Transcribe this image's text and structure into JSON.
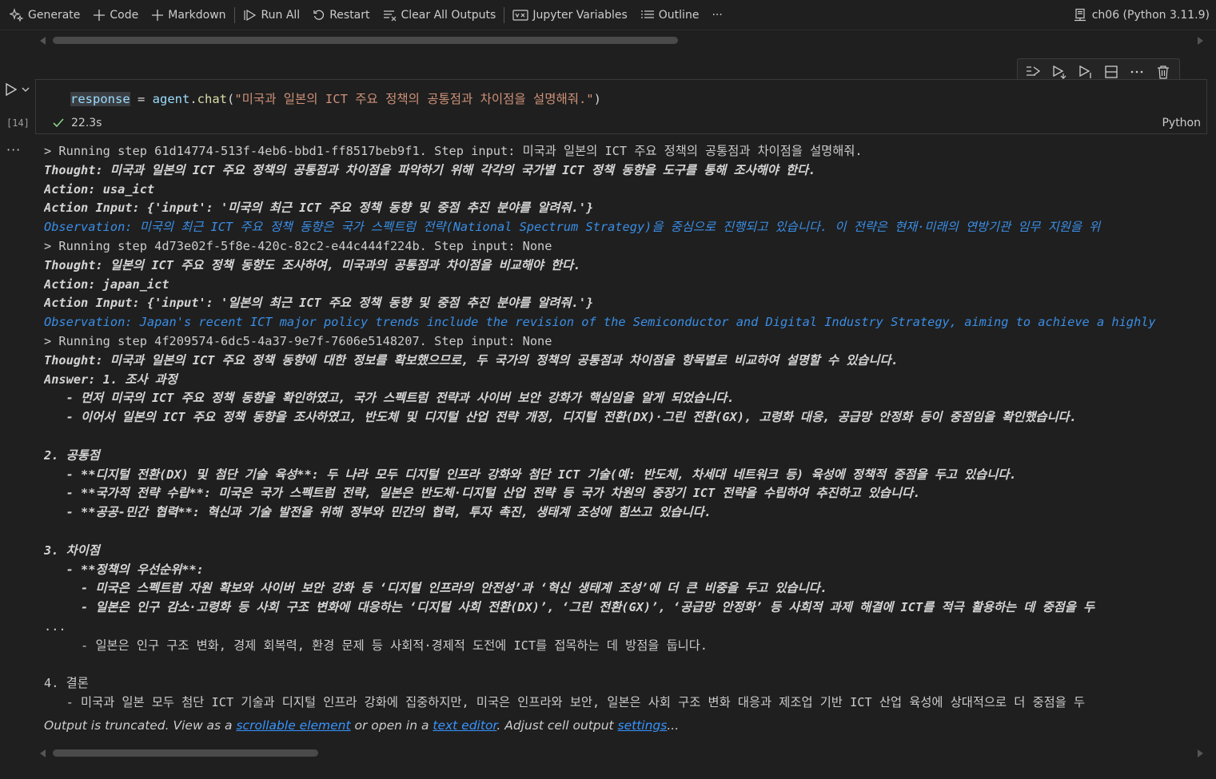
{
  "toolbar": {
    "generate": "Generate",
    "code": "Code",
    "markdown": "Markdown",
    "run_all": "Run All",
    "restart": "Restart",
    "clear_outputs": "Clear All Outputs",
    "variables": "Jupyter Variables",
    "outline": "Outline",
    "more": "···",
    "kernel": "ch06 (Python 3.11.9)"
  },
  "cell": {
    "exec_count": "[14]",
    "code": {
      "var": "response",
      "op": " = ",
      "obj": "agent",
      "dot": ".",
      "fn": "chat",
      "open": "(",
      "str": "\"미국과 일본의 ICT 주요 정책의 공통점과 차이점을 설명해줘.\"",
      "close": ")"
    },
    "duration": "22.3s",
    "language": "Python"
  },
  "output": {
    "more": "···",
    "lines": [
      {
        "text": "> Running step 61d14774-513f-4eb6-bbd1-ff8517beb9f1. Step input: 미국과 일본의 ICT 주요 정책의 공통점과 차이점을 설명해줘.",
        "style": "plain"
      },
      {
        "text": "Thought: 미국과 일본의 ICT 주요 정책의 공통점과 차이점을 파악하기 위해 각각의 국가별 ICT 정책 동향을 도구를 통해 조사해야 한다.",
        "style": "bi"
      },
      {
        "text": "Action: usa_ict",
        "style": "bi"
      },
      {
        "text": "Action Input: {'input': '미국의 최근 ICT 주요 정책 동향 및 중점 추진 분야를 알려줘.'}",
        "style": "bi"
      },
      {
        "text": "Observation: 미국의 최근 ICT 주요 정책 동향은 국가 스펙트럼 전략(National Spectrum Strategy)을 중심으로 진행되고 있습니다. 이 전략은 현재·미래의 연방기관 임무 지원을 위",
        "style": "obs"
      },
      {
        "text": "> Running step 4d73e02f-5f8e-420c-82c2-e44c444f224b. Step input: None",
        "style": "plain"
      },
      {
        "text": "Thought: 일본의 ICT 주요 정책 동향도 조사하여, 미국과의 공통점과 차이점을 비교해야 한다.",
        "style": "bi"
      },
      {
        "text": "Action: japan_ict",
        "style": "bi"
      },
      {
        "text": "Action Input: {'input': '일본의 최근 ICT 주요 정책 동향 및 중점 추진 분야를 알려줘.'}",
        "style": "bi"
      },
      {
        "text": "Observation: Japan's recent ICT major policy trends include the revision of the Semiconductor and Digital Industry Strategy, aiming to achieve a highly",
        "style": "obs"
      },
      {
        "text": "> Running step 4f209574-6dc5-4a37-9e7f-7606e5148207. Step input: None",
        "style": "plain"
      },
      {
        "text": "Thought: 미국과 일본의 ICT 주요 정책 동향에 대한 정보를 확보했으므로, 두 국가의 정책의 공통점과 차이점을 항목별로 비교하여 설명할 수 있습니다.",
        "style": "bi"
      },
      {
        "text": "Answer: 1. 조사 과정",
        "style": "bi"
      },
      {
        "text": "   - 먼저 미국의 ICT 주요 정책 동향을 확인하였고, 국가 스펙트럼 전략과 사이버 보안 강화가 핵심임을 알게 되었습니다.",
        "style": "bi"
      },
      {
        "text": "   - 이어서 일본의 ICT 주요 정책 동향을 조사하였고, 반도체 및 디지털 산업 전략 개정, 디지털 전환(DX)·그린 전환(GX), 고령화 대응, 공급망 안정화 등이 중점임을 확인했습니다.",
        "style": "bi"
      },
      {
        "text": "",
        "style": "bi"
      },
      {
        "text": "2. 공통점",
        "style": "bi"
      },
      {
        "text": "   - **디지털 전환(DX) 및 첨단 기술 육성**: 두 나라 모두 디지털 인프라 강화와 첨단 ICT 기술(예: 반도체, 차세대 네트워크 등) 육성에 정책적 중점을 두고 있습니다.",
        "style": "bi"
      },
      {
        "text": "   - **국가적 전략 수립**: 미국은 국가 스펙트럼 전략, 일본은 반도체·디지털 산업 전략 등 국가 차원의 중장기 ICT 전략을 수립하여 추진하고 있습니다.",
        "style": "bi"
      },
      {
        "text": "   - **공공-민간 협력**: 혁신과 기술 발전을 위해 정부와 민간의 협력, 투자 촉진, 생태계 조성에 힘쓰고 있습니다.",
        "style": "bi"
      },
      {
        "text": "",
        "style": "bi"
      },
      {
        "text": "3. 차이점",
        "style": "bi"
      },
      {
        "text": "   - **정책의 우선순위**:",
        "style": "bi"
      },
      {
        "text": "     - 미국은 스펙트럼 자원 확보와 사이버 보안 강화 등 ‘디지털 인프라의 안전성’과 ‘혁신 생태계 조성’에 더 큰 비중을 두고 있습니다.",
        "style": "bi"
      },
      {
        "text": "     - 일본은 인구 감소·고령화 등 사회 구조 변화에 대응하는 ‘디지털 사회 전환(DX)’, ‘그린 전환(GX)’, ‘공급망 안정화’ 등 사회적 과제 해결에 ICT를 적극 활용하는 데 중점을 두",
        "style": "bi"
      },
      {
        "text": "...",
        "style": "plain"
      },
      {
        "text": "     - 일본은 인구 구조 변화, 경제 회복력, 환경 문제 등 사회적·경제적 도전에 ICT를 접목하는 데 방점을 둡니다.",
        "style": "plain"
      },
      {
        "text": "",
        "style": "plain"
      },
      {
        "text": "4. 결론",
        "style": "plain"
      },
      {
        "text": "   - 미국과 일본 모두 첨단 ICT 기술과 디지털 인프라 강화에 집중하지만, 미국은 인프라와 보안, 일본은 사회 구조 변화 대응과 제조업 기반 ICT 산업 육성에 상대적으로 더 중점을 두",
        "style": "plain"
      }
    ]
  },
  "truncation": {
    "prefix": "Output is truncated. View as a ",
    "link1": "scrollable element",
    "middle": " or open in a ",
    "link2": "text editor",
    "middle2": ". Adjust cell output ",
    "link3": "settings",
    "suffix": "..."
  }
}
